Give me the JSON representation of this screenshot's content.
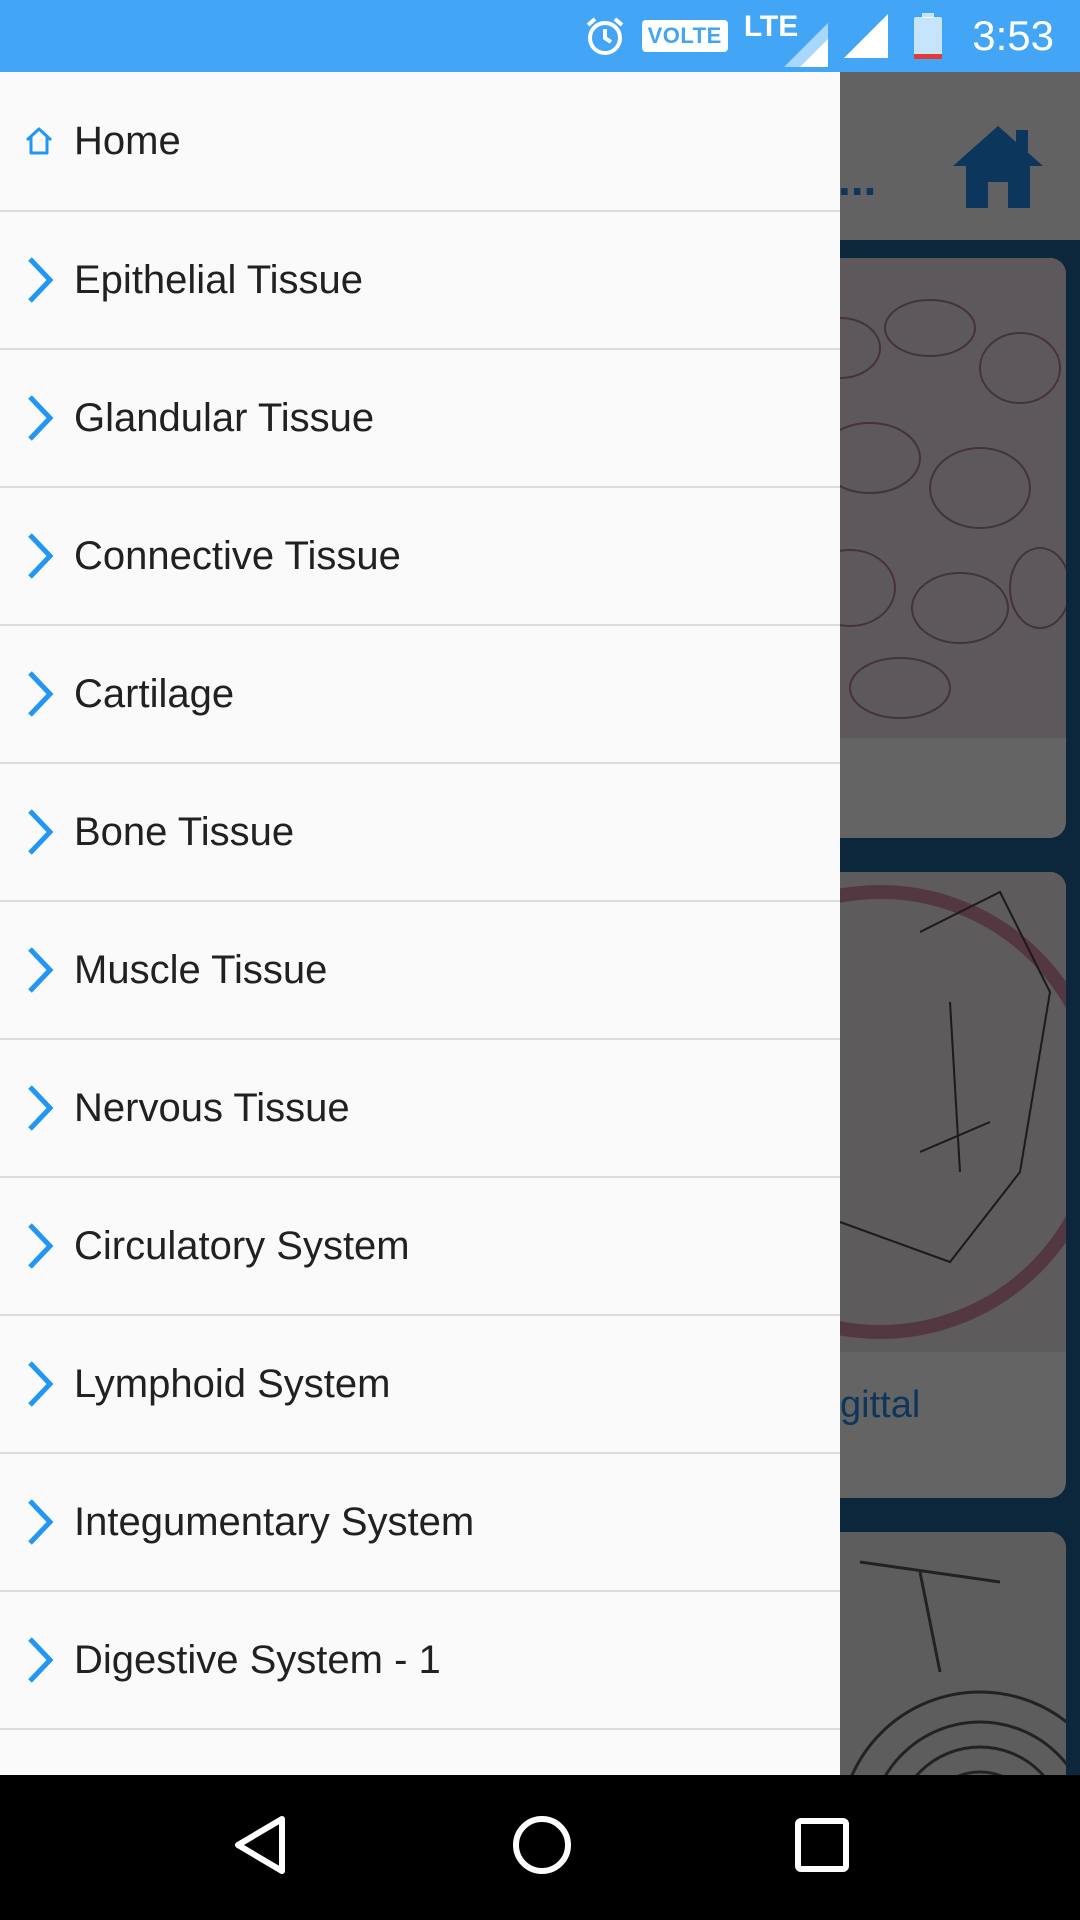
{
  "status_bar": {
    "alarm_icon": "alarm-clock-icon",
    "volte_label": "VOLTE",
    "network_label": "LTE",
    "time": "3:53"
  },
  "background": {
    "toolbar_ellipsis": "...",
    "card_caption_partial": "gittal"
  },
  "drawer": {
    "items": [
      {
        "label": "Home",
        "icon": "home-outline-icon"
      },
      {
        "label": "Epithelial Tissue",
        "icon": "chevron-right-icon"
      },
      {
        "label": "Glandular Tissue",
        "icon": "chevron-right-icon"
      },
      {
        "label": "Connective Tissue",
        "icon": "chevron-right-icon"
      },
      {
        "label": "Cartilage",
        "icon": "chevron-right-icon"
      },
      {
        "label": "Bone Tissue",
        "icon": "chevron-right-icon"
      },
      {
        "label": "Muscle Tissue",
        "icon": "chevron-right-icon"
      },
      {
        "label": "Nervous Tissue",
        "icon": "chevron-right-icon"
      },
      {
        "label": "Circulatory System",
        "icon": "chevron-right-icon"
      },
      {
        "label": "Lymphoid System",
        "icon": "chevron-right-icon"
      },
      {
        "label": "Integumentary System",
        "icon": "chevron-right-icon"
      },
      {
        "label": "Digestive System - 1",
        "icon": "chevron-right-icon"
      }
    ]
  },
  "colors": {
    "accent": "#42a5f5",
    "chevron": "#2196f3",
    "divider": "#dcdcdc"
  }
}
